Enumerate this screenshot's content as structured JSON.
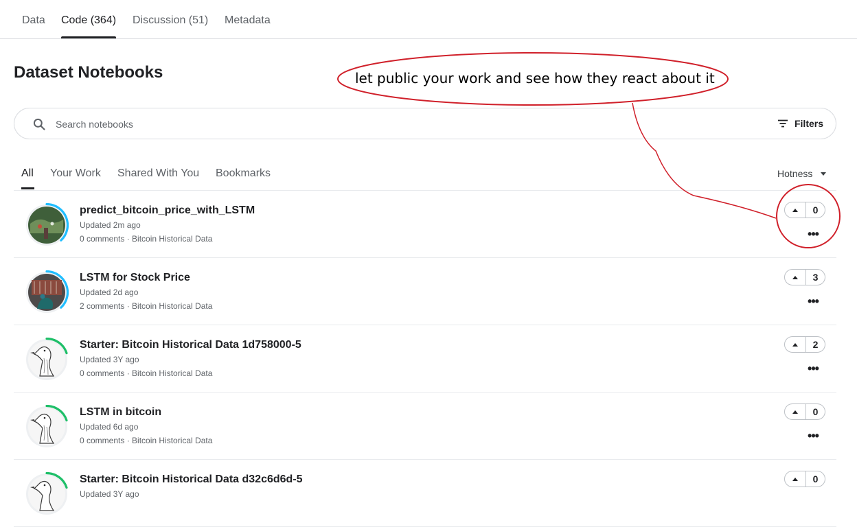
{
  "top_tabs": [
    {
      "label": "Data"
    },
    {
      "label": "Code (364)"
    },
    {
      "label": "Discussion (51)"
    },
    {
      "label": "Metadata"
    }
  ],
  "page": {
    "title": "Dataset Notebooks"
  },
  "search": {
    "placeholder": "Search notebooks",
    "value": "",
    "icon": "search-icon"
  },
  "filters": {
    "label": "Filters",
    "icon": "filter-lines-icon"
  },
  "sub_tabs": [
    {
      "label": "All"
    },
    {
      "label": "Your Work"
    },
    {
      "label": "Shared With You"
    },
    {
      "label": "Bookmarks"
    }
  ],
  "sort": {
    "label": "Hotness"
  },
  "notebooks": [
    {
      "title": "predict_bitcoin_price_with_LSTM",
      "updated": "Updated 2m ago",
      "meta": "0 comments · Bitcoin Historical Data",
      "votes": "0",
      "avatar": "photo-greenery",
      "ring_color": "#20beff",
      "ring_fraction": 0.38
    },
    {
      "title": "LSTM for Stock Price",
      "updated": "Updated 2d ago",
      "meta": "2 comments · Bitcoin Historical Data",
      "votes": "3",
      "avatar": "photo-peacock",
      "ring_color": "#20beff",
      "ring_fraction": 0.38
    },
    {
      "title": "Starter: Bitcoin Historical Data 1d758000-5",
      "updated": "Updated 3Y ago",
      "meta": "0 comments · Bitcoin Historical Data",
      "votes": "2",
      "avatar": "goose-sketch",
      "ring_color": "#1ebf68",
      "ring_fraction": 0.2
    },
    {
      "title": "LSTM in bitcoin",
      "updated": "Updated 6d ago",
      "meta": "0 comments · Bitcoin Historical Data",
      "votes": "0",
      "avatar": "goose-sketch",
      "ring_color": "#1ebf68",
      "ring_fraction": 0.2
    },
    {
      "title": "Starter: Bitcoin Historical Data d32c6d6d-5",
      "updated": "Updated 3Y ago",
      "meta": "",
      "votes": "0",
      "avatar": "goose-sketch",
      "ring_color": "#1ebf68",
      "ring_fraction": 0.2
    }
  ],
  "annotation": {
    "text": "let public your work and see how they react about it",
    "color": "#d0202a"
  }
}
